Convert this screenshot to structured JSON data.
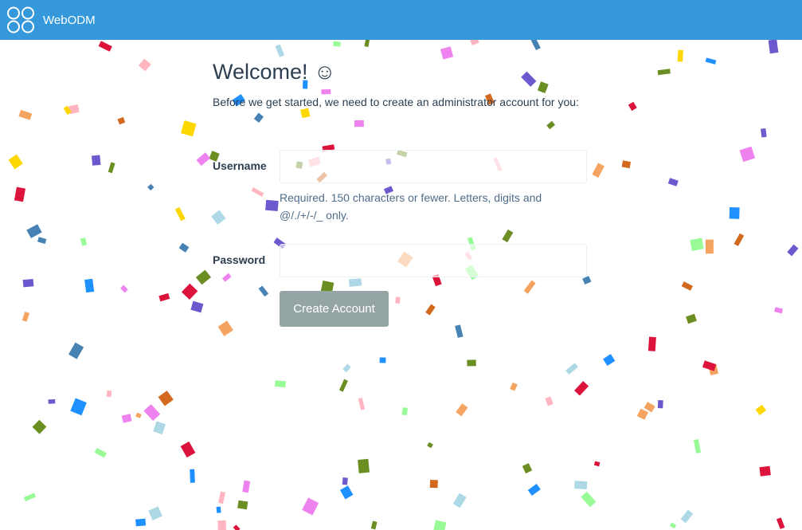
{
  "navbar": {
    "app_name": "WebODM",
    "logo_icon": "webodm-logo-icon",
    "background": "#3498db"
  },
  "page": {
    "title": "Welcome! ☺",
    "intro": "Before we get started, we need to create an administrator account for you:"
  },
  "form": {
    "username_label": "Username",
    "username_value": "",
    "username_help": "Required. 150 characters or fewer. Letters, digits and @/./+/-/_ only.",
    "password_label": "Password",
    "password_value": "",
    "submit_label": "Create Account",
    "submit_color": "#95a5a6"
  },
  "decoration": {
    "confetti_colors": [
      "#dc143c",
      "#6b8e23",
      "#1e90ff",
      "#ffd700",
      "#ee82ee",
      "#d2691e",
      "#6a5acd",
      "#4682b4",
      "#f4a460",
      "#98fb98",
      "#add8e6",
      "#ffb6c1"
    ]
  }
}
